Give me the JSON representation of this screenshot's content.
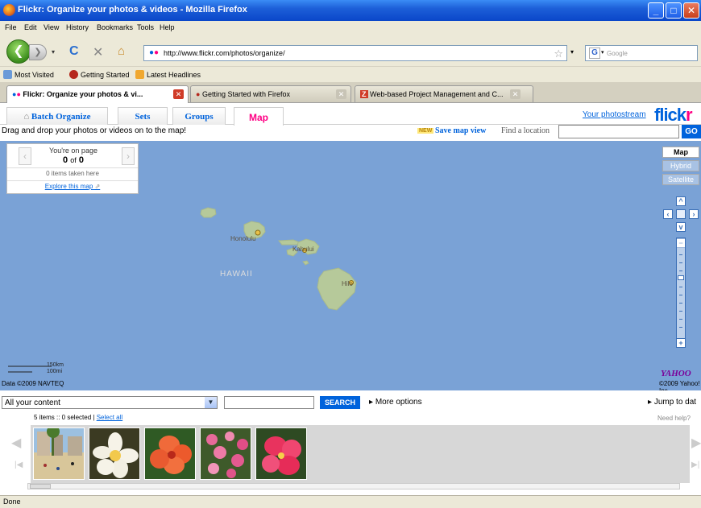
{
  "window": {
    "title": "Flickr: Organize your photos & videos - Mozilla Firefox"
  },
  "menu": [
    "File",
    "Edit",
    "View",
    "History",
    "Bookmarks",
    "Tools",
    "Help"
  ],
  "nav": {
    "url": "http://www.flickr.com/photos/organize/",
    "search_placeholder": "Google"
  },
  "bookmarks": [
    "Most Visited",
    "Getting Started",
    "Latest Headlines"
  ],
  "tabs": [
    {
      "label": "Flickr: Organize your photos & vi..."
    },
    {
      "label": "Getting Started with Firefox"
    },
    {
      "label": "Web-based Project Management and C..."
    }
  ],
  "organizer": {
    "tabs": [
      "Batch Organize",
      "Sets",
      "Groups",
      "Map"
    ],
    "photostream_link": "Your photostream",
    "logo_part1": "flick",
    "logo_part2": "r",
    "instruction": "Drag and drop your photos or videos on to the map!",
    "new_badge": "NEW",
    "save_map_view": "Save map view",
    "find_location_label": "Find a location",
    "go_label": "GO"
  },
  "map": {
    "page_panel": {
      "line1": "You're on page",
      "page": "0",
      "of_label": "of",
      "total": "0",
      "items_taken": "0 items taken here",
      "explore_link": "Explore this map"
    },
    "map_types": [
      "Map",
      "Hybrid",
      "Satellite"
    ],
    "labels": {
      "honolulu": "Honolulu",
      "kahului": "Kahului",
      "hilo": "Hilo",
      "hawaii": "HAWAII"
    },
    "scale_km": "150km",
    "scale_mi": "100mi",
    "data_copyright": "Data ©2009 NAVTEQ",
    "yahoo_logo": "YAHOO",
    "yahoo_copyright": "©2009 Yahoo! Inc"
  },
  "bottom": {
    "content_select": "All your content",
    "search_label": "SEARCH",
    "more_options": "More options",
    "jump_to": "Jump to dat",
    "items_info": "5 items :: 0 selected |",
    "select_all": "Select all",
    "need_help": "Need help?"
  },
  "status": "Done",
  "colors": {
    "flickr_blue": "#0063dc",
    "flickr_pink": "#ff0084",
    "ocean": "#7aa2d6",
    "land": "#b6c99a"
  }
}
